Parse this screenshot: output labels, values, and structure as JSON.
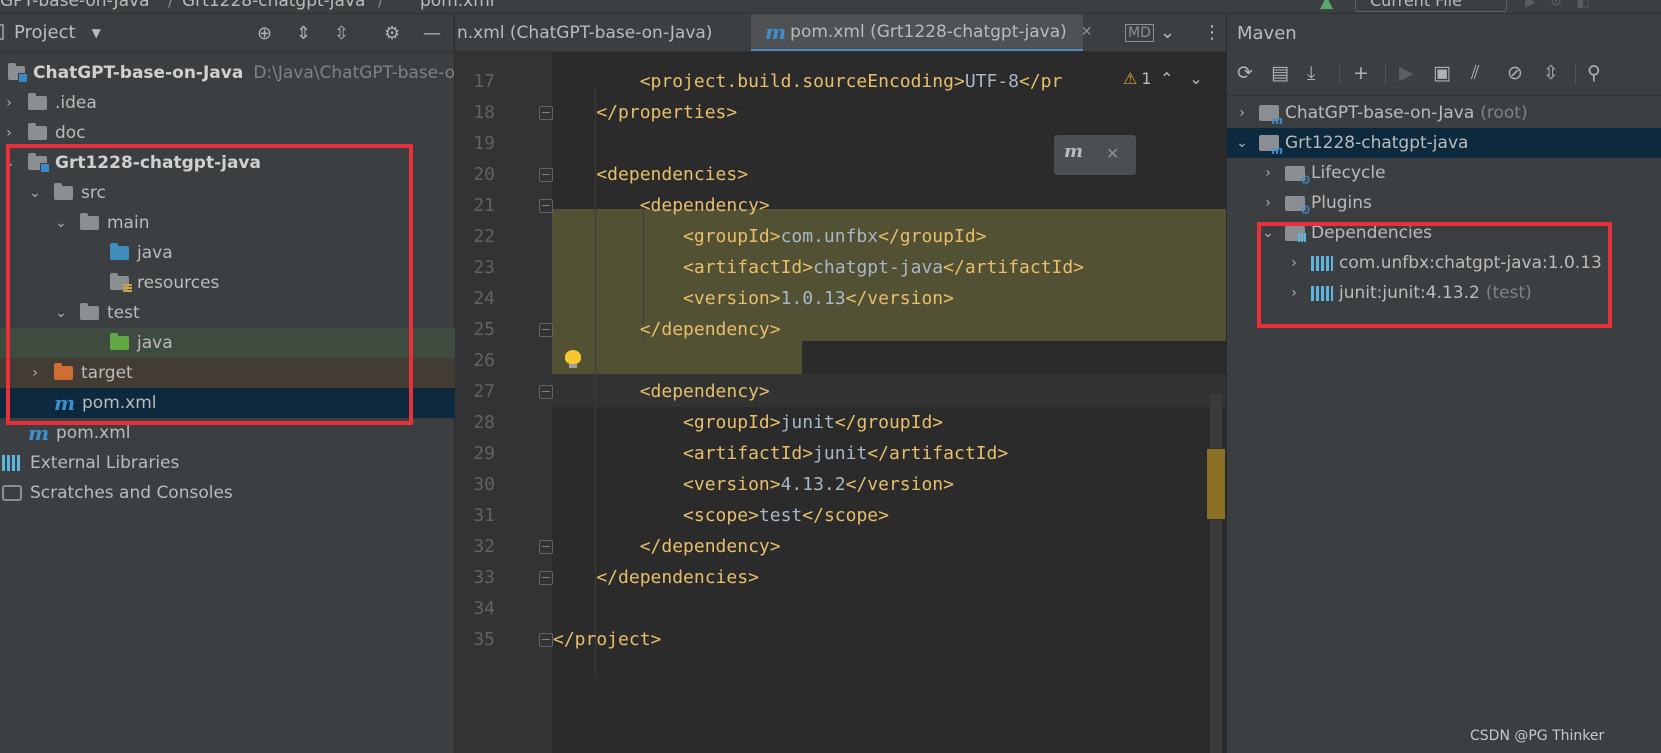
{
  "topbar": {
    "crumb_project": "GPT-base-on-Java",
    "crumb_module": "Grt1228-chatgpt-java",
    "crumb_file": "pom.xml",
    "run_config": "Current File"
  },
  "project": {
    "title": "Project",
    "tree": [
      {
        "label": "ChatGPT-base-on-Java",
        "path": "D:\\Java\\ChatGPT-base-o"
      },
      {
        "label": ".idea"
      },
      {
        "label": "doc"
      },
      {
        "label": "Grt1228-chatgpt-java"
      },
      {
        "label": "src"
      },
      {
        "label": "main"
      },
      {
        "label": "java"
      },
      {
        "label": "resources"
      },
      {
        "label": "test"
      },
      {
        "label": "java"
      },
      {
        "label": "target"
      },
      {
        "label": "pom.xml"
      },
      {
        "label": "pom.xml"
      },
      {
        "label": "External Libraries"
      },
      {
        "label": "Scratches and Consoles"
      }
    ]
  },
  "editor": {
    "tabs": [
      {
        "label": "n.xml (ChatGPT-base-on-Java)"
      },
      {
        "label": "pom.xml (Grt1228-chatgpt-java)"
      }
    ],
    "warning_count": "1",
    "lines": [
      {
        "n": "17",
        "text": "        <project.build.sourceEncoding>UTF-8</pr"
      },
      {
        "n": "18",
        "text": "    </properties>"
      },
      {
        "n": "19",
        "text": ""
      },
      {
        "n": "20",
        "text": "    <dependencies>"
      },
      {
        "n": "21",
        "text": "        <dependency>"
      },
      {
        "n": "22",
        "text": "            <groupId>com.unfbx</groupId>"
      },
      {
        "n": "23",
        "text": "            <artifactId>chatgpt-java</artifactId>"
      },
      {
        "n": "24",
        "text": "            <version>1.0.13</version>"
      },
      {
        "n": "25",
        "text": "        </dependency>"
      },
      {
        "n": "26",
        "text": ""
      },
      {
        "n": "27",
        "text": "        <dependency>"
      },
      {
        "n": "28",
        "text": "            <groupId>junit</groupId>"
      },
      {
        "n": "29",
        "text": "            <artifactId>junit</artifactId>"
      },
      {
        "n": "30",
        "text": "            <version>4.13.2</version>"
      },
      {
        "n": "31",
        "text": "            <scope>test</scope>"
      },
      {
        "n": "32",
        "text": "        </dependency>"
      },
      {
        "n": "33",
        "text": "    </dependencies>"
      },
      {
        "n": "34",
        "text": ""
      },
      {
        "n": "35",
        "text": "</project>"
      }
    ]
  },
  "maven": {
    "title": "Maven",
    "tree": [
      {
        "label": "ChatGPT-base-on-Java",
        "suffix": "(root)"
      },
      {
        "label": "Grt1228-chatgpt-java"
      },
      {
        "label": "Lifecycle"
      },
      {
        "label": "Plugins"
      },
      {
        "label": "Dependencies"
      },
      {
        "label": "com.unfbx:chatgpt-java:1.0.13"
      },
      {
        "label": "junit:junit:4.13.2",
        "suffix": "(test)"
      }
    ]
  },
  "watermark": "CSDN @PG Thinker",
  "colors": {
    "accent": "#4a88c7",
    "highlight_box": "#e8303a",
    "selection": "#0d293e"
  }
}
